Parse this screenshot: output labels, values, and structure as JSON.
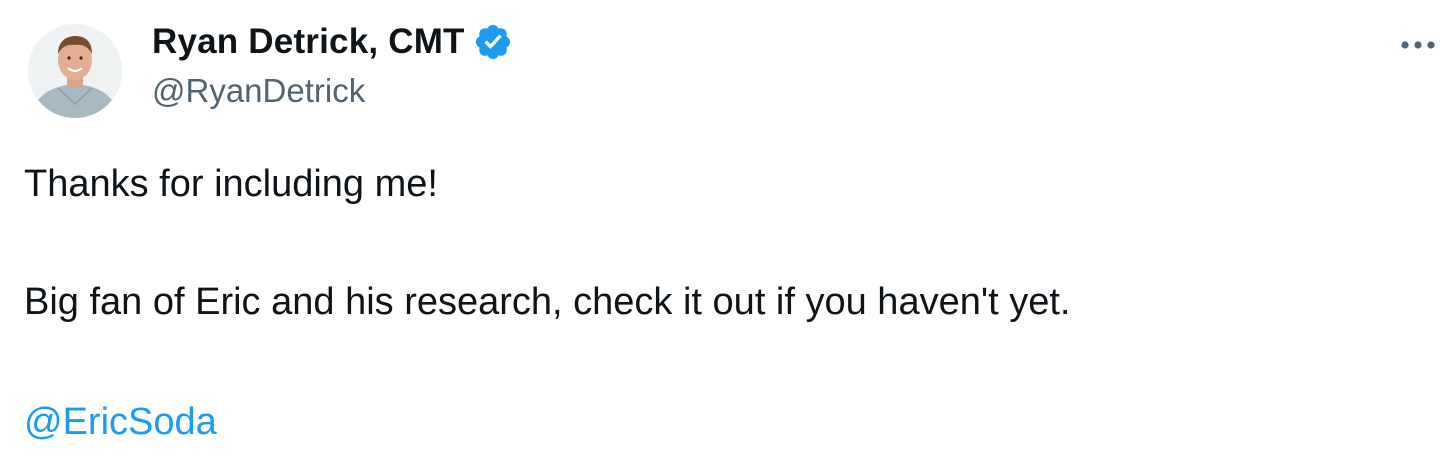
{
  "author": {
    "display_name": "Ryan Detrick, CMT",
    "handle": "@RyanDetrick",
    "verified_icon": "verified-badge-icon",
    "avatar_icon": "profile-photo"
  },
  "tweet": {
    "line1": "Thanks for including me!",
    "line2": "Big fan of Eric and his research, check it out if you haven't yet.",
    "mention": "@EricSoda"
  },
  "menu": {
    "icon": "more-options-icon"
  },
  "colors": {
    "text": "#0f1419",
    "secondary": "#536471",
    "link": "#1d9bf0",
    "verified": "#1d9bf0",
    "background": "#ffffff"
  }
}
